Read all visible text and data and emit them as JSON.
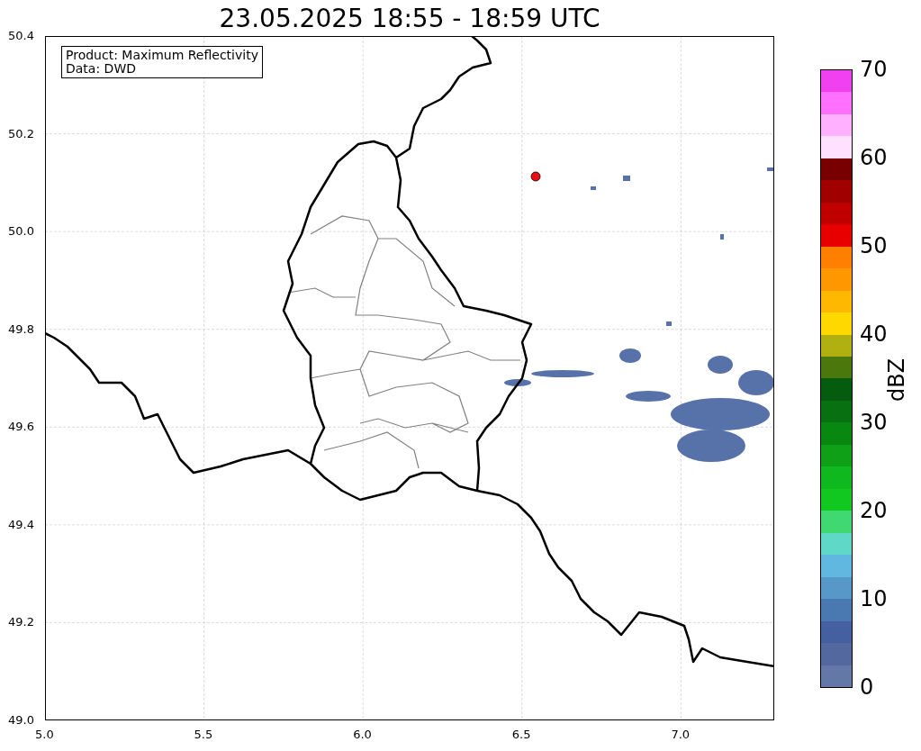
{
  "title": "23.05.2025 18:55 - 18:59 UTC",
  "info_box": {
    "lines": [
      "Product: Maximum Reflectivity",
      "Data: DWD"
    ]
  },
  "y_axis": {
    "ticks": [
      "50.4",
      "50.2",
      "50.0",
      "49.8",
      "49.6",
      "49.4",
      "49.2",
      "49.0"
    ]
  },
  "x_axis": {
    "ticks": [
      "5.0",
      "5.5",
      "6.0",
      "6.5",
      "7.0"
    ]
  },
  "colorbar": {
    "label": "dBZ",
    "ticks": [
      "70",
      "60",
      "50",
      "40",
      "30",
      "20",
      "10",
      "0"
    ],
    "bands": [
      {
        "color": "#6478a8"
      },
      {
        "color": "#5468a0"
      },
      {
        "color": "#4460a0"
      },
      {
        "color": "#4a78b0"
      },
      {
        "color": "#5898c8"
      },
      {
        "color": "#60b8e0"
      },
      {
        "color": "#60d8c8"
      },
      {
        "color": "#40d870"
      },
      {
        "color": "#10c820"
      },
      {
        "color": "#10b820"
      },
      {
        "color": "#10a018"
      },
      {
        "color": "#088810"
      },
      {
        "color": "#087010"
      },
      {
        "color": "#065c0e"
      },
      {
        "color": "#4a780c"
      },
      {
        "color": "#b0b010"
      },
      {
        "color": "#ffd800"
      },
      {
        "color": "#ffb800"
      },
      {
        "color": "#ff9800"
      },
      {
        "color": "#ff8000"
      },
      {
        "color": "#e80000"
      },
      {
        "color": "#c00000"
      },
      {
        "color": "#a00000"
      },
      {
        "color": "#780000"
      },
      {
        "color": "#ffe0ff"
      },
      {
        "color": "#ffb0ff"
      },
      {
        "color": "#ff70ff"
      },
      {
        "color": "#f040f0"
      }
    ]
  }
}
